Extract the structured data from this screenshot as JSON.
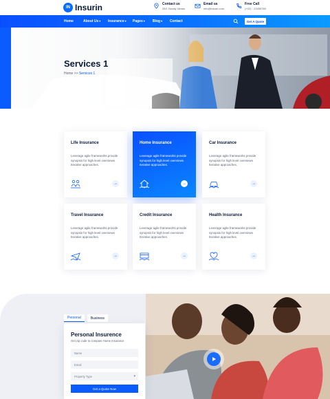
{
  "brand": {
    "name": "Insurin",
    "mark": "IN"
  },
  "contacts": [
    {
      "title": "Contact us",
      "value": "25/1 Noraly Ukrain"
    },
    {
      "title": "Email us",
      "value": "info@insurn.com"
    },
    {
      "title": "Free Call",
      "value": "(+02) - 23456789"
    }
  ],
  "nav": {
    "items": [
      "Home",
      "About Us",
      "Insurance",
      "Pages",
      "Blog",
      "Contact"
    ],
    "quote_button": "Get A Quote"
  },
  "hero": {
    "title": "Services 1",
    "breadcrumb_home": "Home",
    "breadcrumb_sep": " >> ",
    "breadcrumb_current": "Services 1"
  },
  "cards": [
    {
      "title": "Life Insurance",
      "desc": "Leverage agile frameworks provide synopsis for high level overviews Iterative approaches.",
      "icon": "family-icon",
      "active": false
    },
    {
      "title": "Home Insurance",
      "desc": "Leverage agile frameworks provide synopsis for high level overviews Iterative approaches.",
      "icon": "house-icon",
      "active": true
    },
    {
      "title": "Car Insurance",
      "desc": "Leverage agile frameworks provide synopsis for high level overviews Iterative approaches.",
      "icon": "car-icon",
      "active": false
    },
    {
      "title": "Travel Insurance",
      "desc": "Leverage agile frameworks provide synopsis for high level overviews Iterative approaches.",
      "icon": "plane-icon",
      "active": false
    },
    {
      "title": "Credit Insurance",
      "desc": "Leverage agile frameworks provide synopsis for high level overviews Iterative approaches.",
      "icon": "credit-icon",
      "active": false
    },
    {
      "title": "Health Insurance",
      "desc": "Leverage agile frameworks provide synopsis for high level overviews Iterative approaches.",
      "icon": "health-icon",
      "active": false
    }
  ],
  "quote_form": {
    "tabs": [
      "Personal",
      "Business"
    ],
    "title": "Personal Insurence",
    "subtitle": "Get zip code to compare Home Insurance",
    "name_placeholder": "Name",
    "email_placeholder": "Email",
    "property_select": "Property Type",
    "submit": "Get a Quote Now"
  },
  "colors": {
    "primary": "#0a5cff",
    "dark": "#0b1a3a",
    "muted": "#5a6275"
  }
}
